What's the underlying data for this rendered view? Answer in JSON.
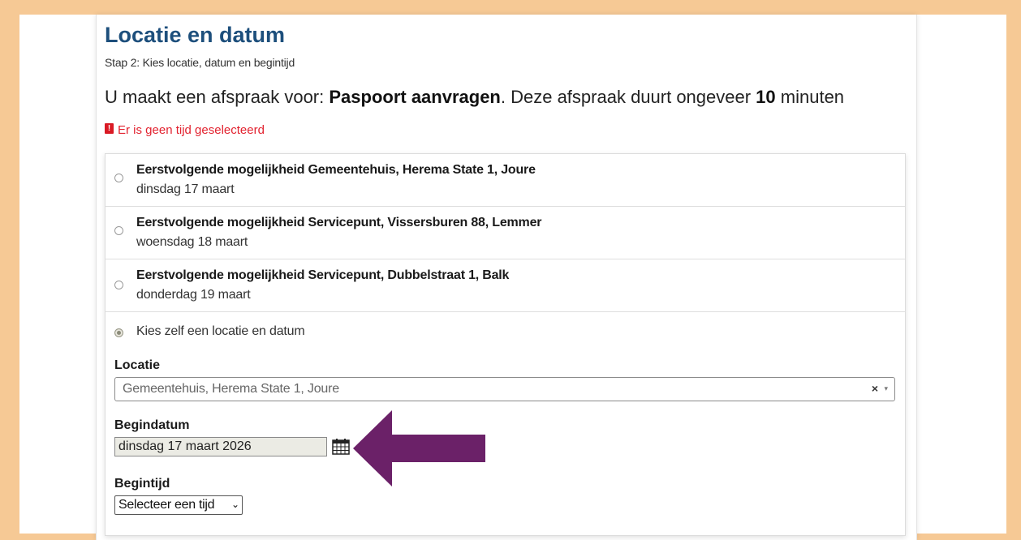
{
  "page": {
    "title": "Locatie en datum",
    "step": "Stap 2: Kies locatie, datum en begintijd",
    "intro": {
      "prefix": "U maakt een afspraak voor: ",
      "product": "Paspoort aanvragen",
      "middle": ". Deze afspraak duurt ongeveer ",
      "duration": "10",
      "suffix": " minuten"
    },
    "error": "Er is geen tijd geselecteerd",
    "error_icon": "!"
  },
  "options": [
    {
      "title": "Eerstvolgende mogelijkheid Gemeentehuis, Herema State 1, Joure",
      "date": "dinsdag 17 maart",
      "selected": false
    },
    {
      "title": "Eerstvolgende mogelijkheid Servicepunt, Vissersburen 88, Lemmer",
      "date": "woensdag 18 maart",
      "selected": false
    },
    {
      "title": "Eerstvolgende mogelijkheid Servicepunt, Dubbelstraat 1, Balk",
      "date": "donderdag 19 maart",
      "selected": false
    }
  ],
  "custom": {
    "label": "Kies zelf een locatie en datum",
    "selected": true,
    "location_label": "Locatie",
    "location_value": "Gemeentehuis, Herema State 1, Joure",
    "clear_glyph": "×",
    "dropdown_glyph": "▾",
    "startdate_label": "Begindatum",
    "startdate_value": "dinsdag 17 maart 2026",
    "calendar_icon": "calendar-icon",
    "starttime_label": "Begintijd",
    "starttime_value": "Selecteer een tijd",
    "starttime_arrow": "⌄"
  },
  "colors": {
    "frame": "#f6c995",
    "title": "#1d4f7c",
    "error": "#e2222f",
    "arrow": "#6b2168"
  }
}
